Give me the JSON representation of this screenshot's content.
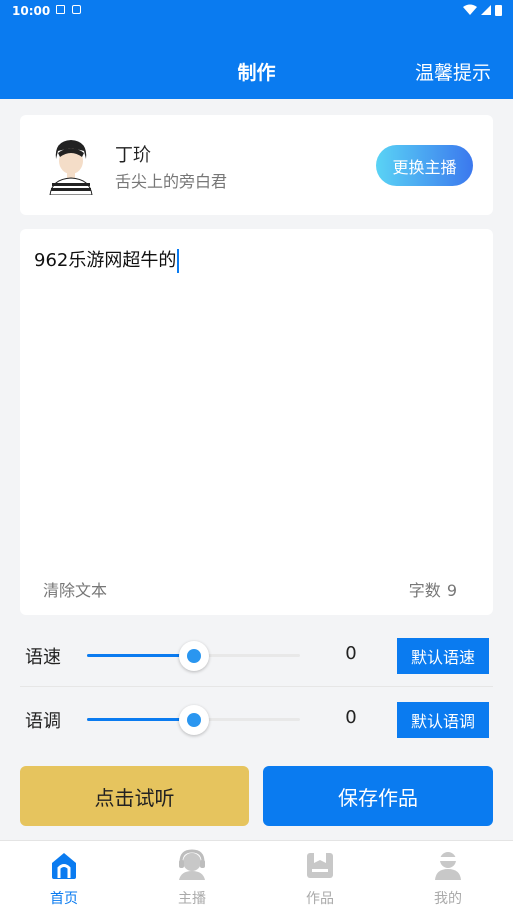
{
  "status_bar": {
    "time": "10:00",
    "icons": [
      "notification-a-icon",
      "keyboard-icon",
      "wifi-icon",
      "signal-icon",
      "battery-icon"
    ]
  },
  "header": {
    "title": "制作",
    "hint_label": "温馨提示",
    "bg_color": "#0a7bf0"
  },
  "anchor": {
    "name": "丁玠",
    "subtitle": "舌尖上的旁白君",
    "change_label": "更换主播"
  },
  "editor": {
    "text": "962乐游网超牛的",
    "clear_label": "清除文本",
    "count_label": "字数",
    "count_value": "9"
  },
  "speed": {
    "label": "语速",
    "value": "0",
    "default_label": "默认语速",
    "level": 0.5
  },
  "pitch": {
    "label": "语调",
    "value": "0",
    "default_label": "默认语调",
    "level": 0.5
  },
  "actions": {
    "listen_label": "点击试听",
    "save_label": "保存作品",
    "listen_color": "#e6c45e"
  },
  "tabbar": {
    "items": [
      {
        "label": "首页",
        "icon": "home-icon",
        "active": true
      },
      {
        "label": "主播",
        "icon": "anchor-icon",
        "active": false
      },
      {
        "label": "作品",
        "icon": "works-icon",
        "active": false
      },
      {
        "label": "我的",
        "icon": "profile-icon",
        "active": false
      }
    ]
  }
}
